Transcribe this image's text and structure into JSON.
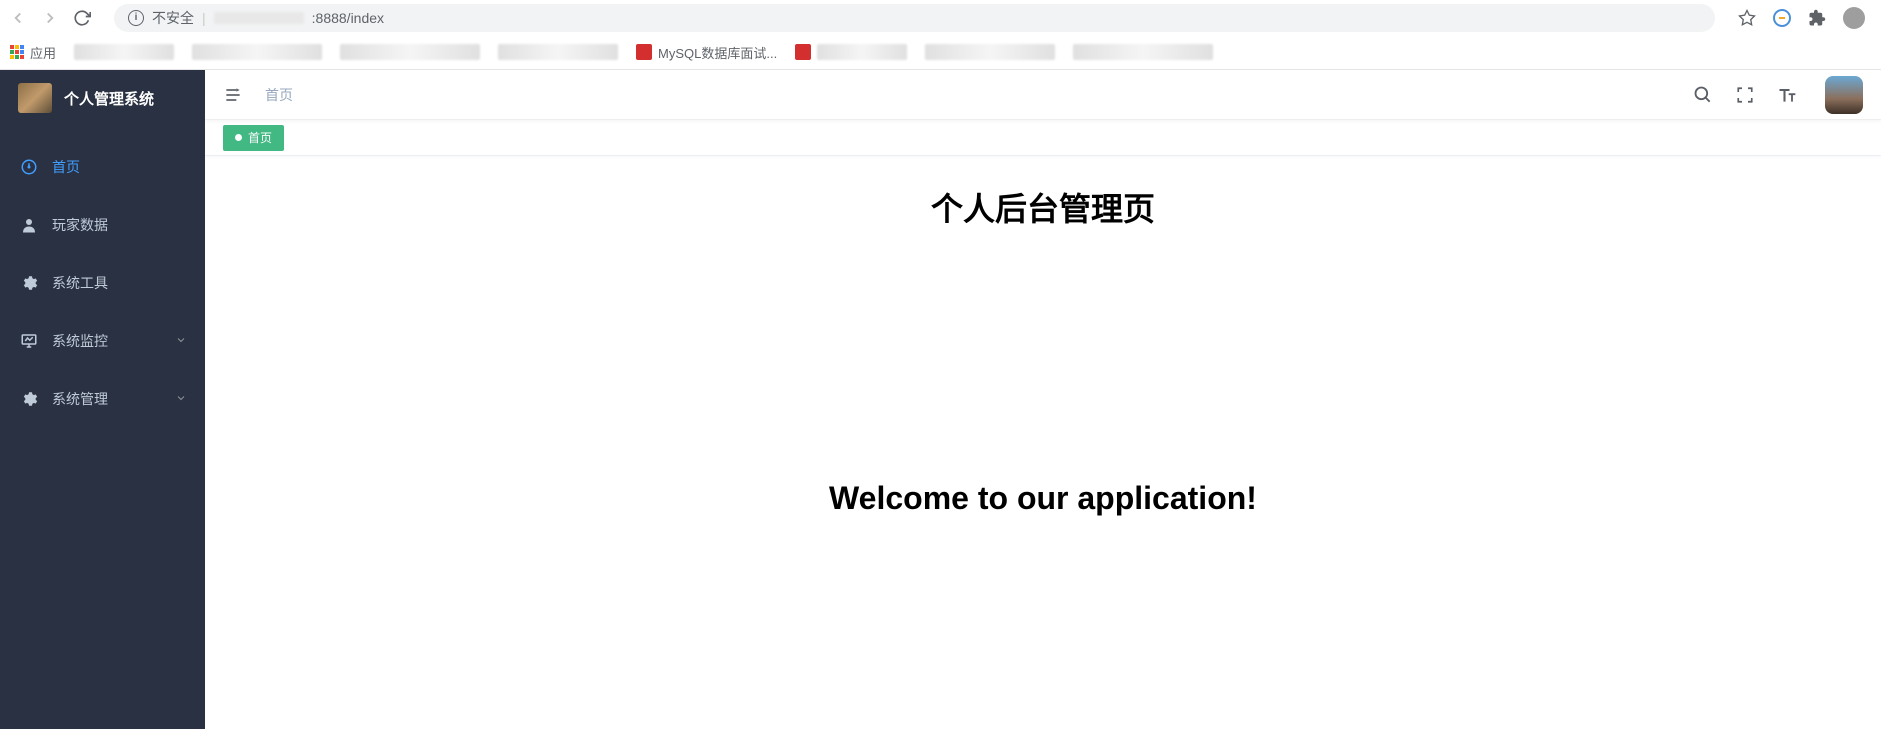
{
  "browser": {
    "security_label": "不安全",
    "url_suffix": ":8888/index",
    "apps_label": "应用",
    "bookmarks": {
      "mysql": "MySQL数据库面试..."
    }
  },
  "sidebar": {
    "title": "个人管理系统",
    "items": [
      {
        "label": "首页",
        "icon": "dashboard",
        "active": true,
        "expandable": false
      },
      {
        "label": "玩家数据",
        "icon": "user",
        "active": false,
        "expandable": false
      },
      {
        "label": "系统工具",
        "icon": "gear",
        "active": false,
        "expandable": false
      },
      {
        "label": "系统监控",
        "icon": "monitor",
        "active": false,
        "expandable": true
      },
      {
        "label": "系统管理",
        "icon": "gear",
        "active": false,
        "expandable": true
      }
    ]
  },
  "header": {
    "breadcrumb": "首页"
  },
  "tabs": [
    {
      "label": "首页",
      "active": true
    }
  ],
  "content": {
    "heading": "个人后台管理页",
    "subheading": "Welcome to our application!"
  }
}
